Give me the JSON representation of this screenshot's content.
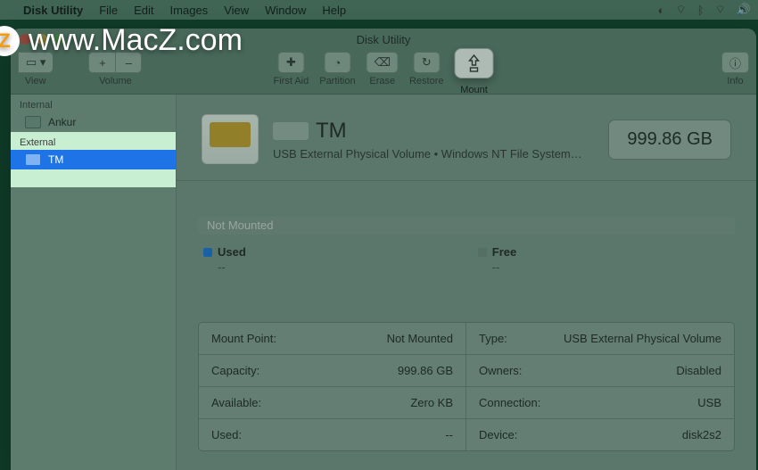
{
  "menubar": {
    "app_name": "Disk Utility",
    "items": [
      "File",
      "Edit",
      "Images",
      "View",
      "Window",
      "Help"
    ],
    "right_icons": [
      "sync-icon",
      "wifi-router-icon",
      "bluetooth-icon",
      "wifi-icon",
      "volume-icon",
      "battery-icon",
      "control-center-icon"
    ]
  },
  "watermark": {
    "logo_letter": "Z",
    "text": "www.MacZ.com"
  },
  "window": {
    "title": "Disk Utility",
    "toolbar": {
      "view_label": "View",
      "volume_label": "Volume",
      "first_aid_label": "First Aid",
      "partition_label": "Partition",
      "erase_label": "Erase",
      "restore_label": "Restore",
      "mount_label": "Mount",
      "info_label": "Info",
      "plus": "+",
      "minus": "–"
    }
  },
  "sidebar": {
    "internal_header": "Internal",
    "internal_items": [
      {
        "name": "Ankur"
      }
    ],
    "external_header": "External",
    "external_items": [
      {
        "name": "TM",
        "selected": true
      }
    ]
  },
  "volume": {
    "name": "TM",
    "subtitle": "USB External Physical Volume • Windows NT File System…",
    "size": "999.86 GB",
    "status": "Not Mounted",
    "usage": {
      "used_label": "Used",
      "used_value": "--",
      "free_label": "Free",
      "free_value": "--"
    },
    "info": {
      "mount_point_label": "Mount Point:",
      "mount_point_value": "Not Mounted",
      "capacity_label": "Capacity:",
      "capacity_value": "999.86 GB",
      "available_label": "Available:",
      "available_value": "Zero KB",
      "used_label": "Used:",
      "used_value": "--",
      "type_label": "Type:",
      "type_value": "USB External Physical Volume",
      "owners_label": "Owners:",
      "owners_value": "Disabled",
      "connection_label": "Connection:",
      "connection_value": "USB",
      "device_label": "Device:",
      "device_value": "disk2s2"
    }
  }
}
